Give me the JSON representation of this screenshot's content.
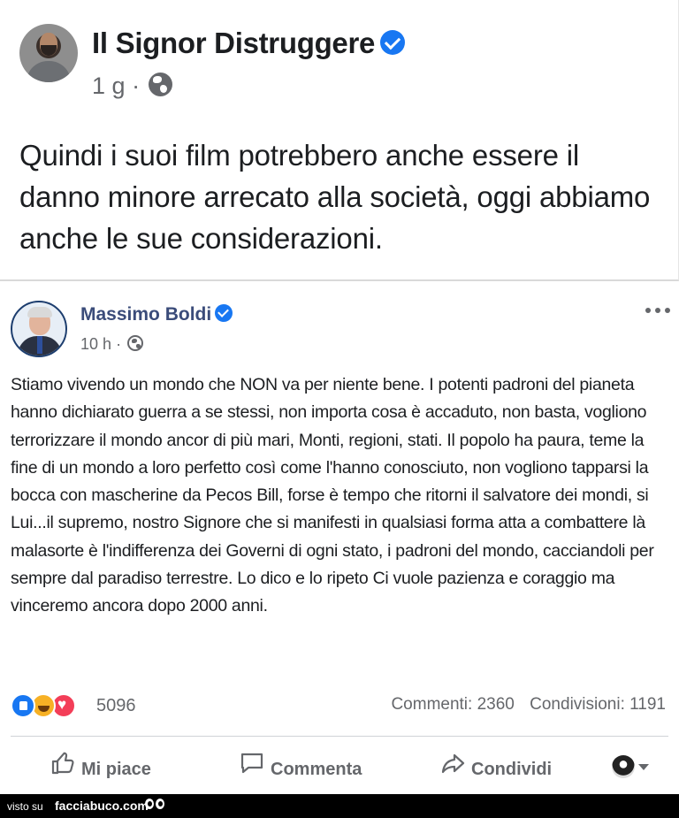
{
  "outer_post": {
    "author": "Il Signor Distruggere",
    "time": "1 g",
    "separator": "·",
    "body": "Quindi i suoi film potrebbero anche essere il danno minore arrecato alla società, oggi abbiamo anche le sue considerazioni."
  },
  "inner_post": {
    "author": "Massimo Boldi",
    "time": "10 h",
    "separator": "·",
    "body": "Stiamo vivendo un mondo che NON va per niente bene. I potenti padroni del pianeta hanno dichiarato guerra a se stessi, non importa cosa è accaduto, non basta, vogliono terrorizzare il mondo ancor di più mari, Monti, regioni, stati. Il popolo ha paura, teme la fine di un mondo a loro perfetto così come l'hanno conosciuto, non vogliono tapparsi la bocca con mascherine da Pecos Bill, forse è tempo che ritorni il salvatore dei mondi, si Lui...il supremo, nostro Signore che si manifesti in qualsiasi forma atta a combattere là malasorte è l'indifferenza dei Governi di ogni stato, i padroni del mondo, cacciandoli per sempre dal paradiso terrestre. Lo dico e lo ripeto Ci vuole pazienza e coraggio ma vinceremo ancora dopo 2000 anni.",
    "reaction_count": "5096",
    "reactions": [
      "like",
      "haha",
      "love"
    ],
    "comments": "Commenti: 2360",
    "shares": "Condivisioni: 1191",
    "actions": {
      "like": "Mi piace",
      "comment": "Commenta",
      "share": "Condividi"
    }
  },
  "footer": {
    "prefix": "visto su",
    "site": "facciabuco.com"
  },
  "colors": {
    "facebook_blue": "#1877f2",
    "name_blue": "#3b4c7a",
    "meta_gray": "#65676b",
    "text": "#1c1e21",
    "love_red": "#f33e58",
    "haha_yellow": "#f7b125"
  }
}
